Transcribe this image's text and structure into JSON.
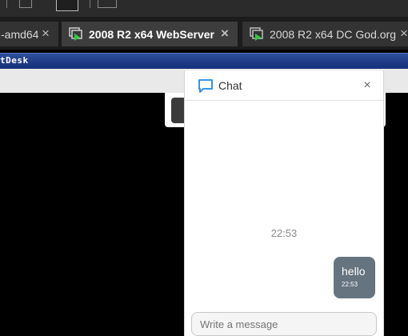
{
  "tabs": [
    {
      "label": "-amd64",
      "active": false,
      "icon": "remote-desktop-icon"
    },
    {
      "label": "2008 R2 x64 WebServer",
      "active": true,
      "icon": "remote-desktop-play-icon"
    },
    {
      "label": "2008 R2 x64 DC God.org",
      "active": false,
      "icon": "remote-desktop-play-icon"
    }
  ],
  "tab_close_glyph": "×",
  "session": {
    "title": "tDesk"
  },
  "chat": {
    "title": "Chat",
    "close_glyph": "×",
    "time_separator": "22:53",
    "messages": [
      {
        "text": "hello",
        "time": "22:53",
        "from": "me"
      }
    ],
    "input_placeholder": "Write a message"
  },
  "colors": {
    "accent": "#1e88e5",
    "bubble": "#65747f",
    "session_bar": "#1e3b86",
    "tab_play": "#2ecc40"
  }
}
